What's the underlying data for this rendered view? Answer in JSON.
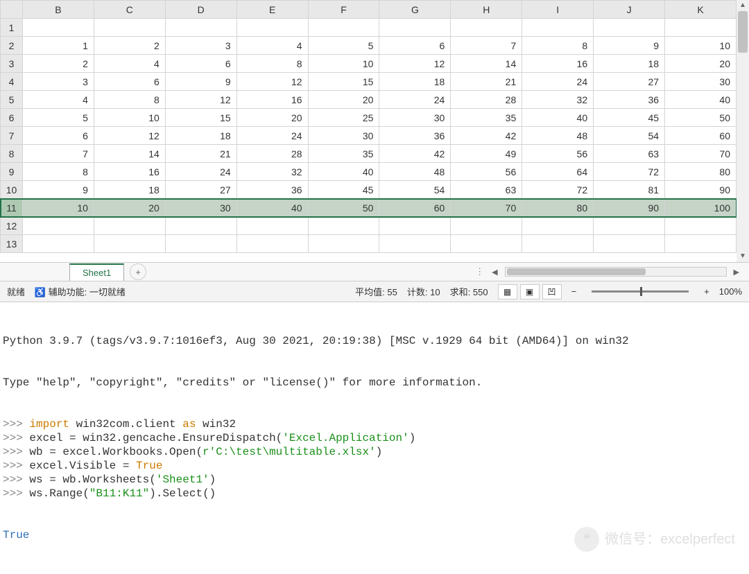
{
  "columns": [
    "B",
    "C",
    "D",
    "E",
    "F",
    "G",
    "H",
    "I",
    "J",
    "K"
  ],
  "rows": [
    "1",
    "2",
    "3",
    "4",
    "5",
    "6",
    "7",
    "8",
    "9",
    "10",
    "11",
    "12",
    "13"
  ],
  "selected_row": "11",
  "data": {
    "2": [
      1,
      2,
      3,
      4,
      5,
      6,
      7,
      8,
      9,
      10
    ],
    "3": [
      2,
      4,
      6,
      8,
      10,
      12,
      14,
      16,
      18,
      20
    ],
    "4": [
      3,
      6,
      9,
      12,
      15,
      18,
      21,
      24,
      27,
      30
    ],
    "5": [
      4,
      8,
      12,
      16,
      20,
      24,
      28,
      32,
      36,
      40
    ],
    "6": [
      5,
      10,
      15,
      20,
      25,
      30,
      35,
      40,
      45,
      50
    ],
    "7": [
      6,
      12,
      18,
      24,
      30,
      36,
      42,
      48,
      54,
      60
    ],
    "8": [
      7,
      14,
      21,
      28,
      35,
      42,
      49,
      56,
      63,
      70
    ],
    "9": [
      8,
      16,
      24,
      32,
      40,
      48,
      56,
      64,
      72,
      80
    ],
    "10": [
      9,
      18,
      27,
      36,
      45,
      54,
      63,
      72,
      81,
      90
    ],
    "11": [
      10,
      20,
      30,
      40,
      50,
      60,
      70,
      80,
      90,
      100
    ]
  },
  "sheet_tab": "Sheet1",
  "status": {
    "ready": "就绪",
    "accessibility": "辅助功能: 一切就绪",
    "avg_label": "平均值:",
    "avg": "55",
    "count_label": "计数:",
    "count": "10",
    "sum_label": "求和:",
    "sum": "550",
    "zoom": "100%"
  },
  "console": {
    "header1": "Python 3.9.7 (tags/v3.9.7:1016ef3, Aug 30 2021, 20:19:38) [MSC v.1929 64 bit (AMD64)] on win32",
    "header2": "Type \"help\", \"copyright\", \"credits\" or \"license()\" for more information.",
    "lines": [
      {
        "prompt": ">>> ",
        "tokens": [
          [
            "kw-import",
            "import"
          ],
          [
            "",
            " win32com.client "
          ],
          [
            "kw-as",
            "as"
          ],
          [
            "",
            " win32"
          ]
        ]
      },
      {
        "prompt": ">>> ",
        "tokens": [
          [
            "",
            "excel = win32.gencache.EnsureDispatch("
          ],
          [
            "str",
            "'Excel.Application'"
          ],
          [
            "",
            ")"
          ]
        ]
      },
      {
        "prompt": ">>> ",
        "tokens": [
          [
            "",
            "wb = excel.Workbooks.Open("
          ],
          [
            "rstr",
            "r'C:\\test\\multitable.xlsx'"
          ],
          [
            "",
            ")"
          ]
        ]
      },
      {
        "prompt": ">>> ",
        "tokens": [
          [
            "",
            "excel.Visible = "
          ],
          [
            "kw-true",
            "True"
          ]
        ]
      },
      {
        "prompt": ">>> ",
        "tokens": [
          [
            "",
            "ws = wb.Worksheets("
          ],
          [
            "str",
            "'Sheet1'"
          ],
          [
            "",
            ")"
          ]
        ]
      },
      {
        "prompt": ">>> ",
        "tokens": [
          [
            "",
            "ws.Range("
          ],
          [
            "str",
            "\"B11:K11\""
          ],
          [
            "",
            ").Select()"
          ]
        ]
      }
    ],
    "output": "True"
  },
  "watermark": "微信号：excelperfect"
}
